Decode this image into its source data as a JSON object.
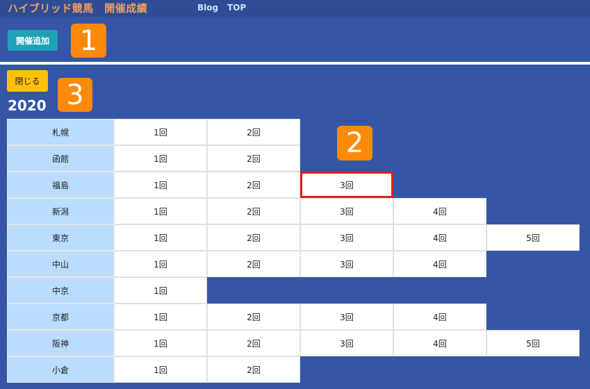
{
  "header": {
    "brand": "ハイブリッド競馬　開催成績",
    "nav": [
      "Blog",
      "TOP"
    ]
  },
  "toolbar": {
    "add_label": "開催追加"
  },
  "markers": [
    "1",
    "2",
    "3"
  ],
  "panel": {
    "close_label": "閉じる",
    "year": "2020"
  },
  "venues": [
    {
      "name": "札幌",
      "meetings": [
        "1回",
        "2回"
      ]
    },
    {
      "name": "函館",
      "meetings": [
        "1回",
        "2回"
      ]
    },
    {
      "name": "福島",
      "meetings": [
        "1回",
        "2回",
        "3回"
      ]
    },
    {
      "name": "新潟",
      "meetings": [
        "1回",
        "2回",
        "3回",
        "4回"
      ]
    },
    {
      "name": "東京",
      "meetings": [
        "1回",
        "2回",
        "3回",
        "4回",
        "5回"
      ]
    },
    {
      "name": "中山",
      "meetings": [
        "1回",
        "2回",
        "3回",
        "4回"
      ]
    },
    {
      "name": "中京",
      "meetings": [
        "1回"
      ]
    },
    {
      "name": "京都",
      "meetings": [
        "1回",
        "2回",
        "3回",
        "4回"
      ]
    },
    {
      "name": "阪神",
      "meetings": [
        "1回",
        "2回",
        "3回",
        "4回",
        "5回"
      ]
    },
    {
      "name": "小倉",
      "meetings": [
        "1回",
        "2回"
      ]
    }
  ],
  "highlighted": {
    "venue_index": 2,
    "meeting_index": 2
  },
  "colors": {
    "background": "#3556a6",
    "brand": "#f0a060",
    "add_button": "#1fa2b8",
    "close_button": "#ffc107",
    "marker": "#ff8a0a",
    "venue_cell": "#b9dcff",
    "highlight": "#e31b1b"
  }
}
